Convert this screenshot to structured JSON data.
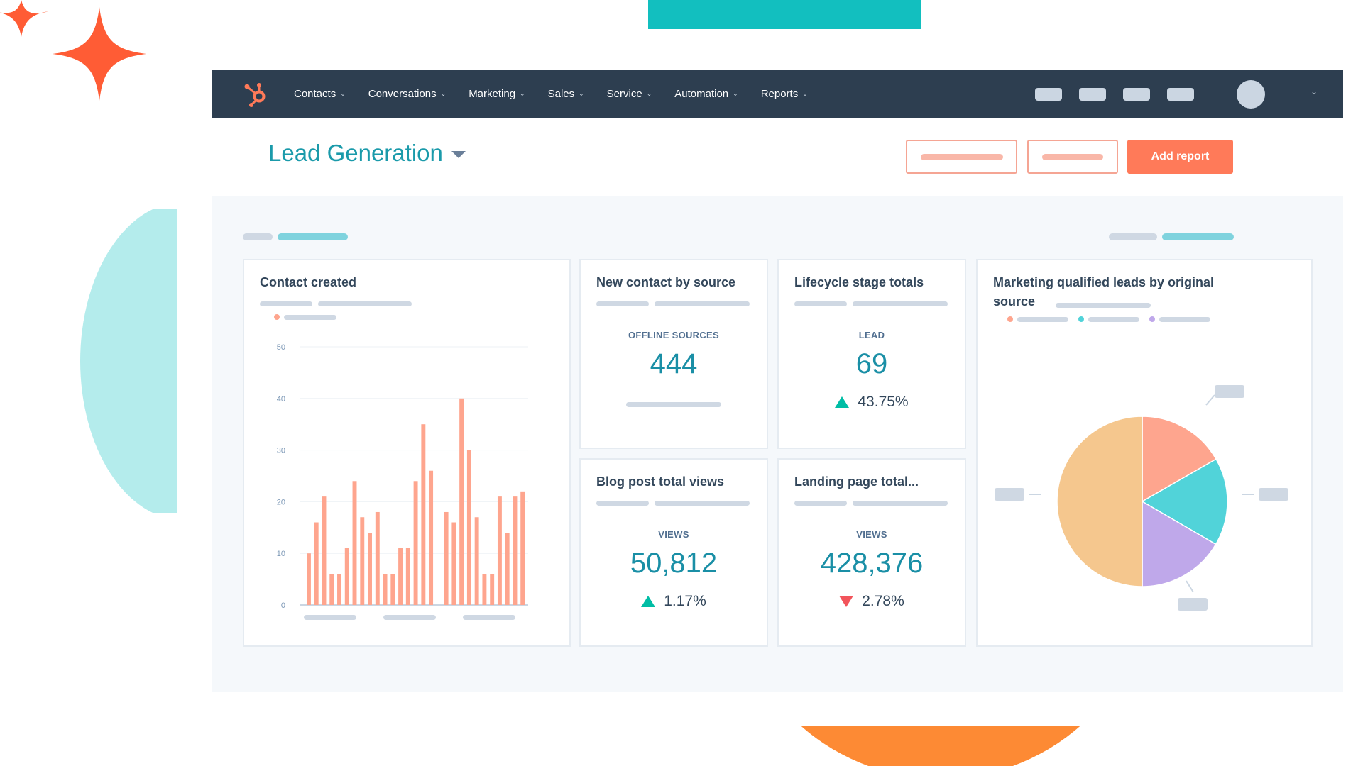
{
  "nav": {
    "logo": "hubspot-sprocket-icon",
    "items": [
      {
        "label": "Contacts"
      },
      {
        "label": "Conversations"
      },
      {
        "label": "Marketing"
      },
      {
        "label": "Sales"
      },
      {
        "label": "Service"
      },
      {
        "label": "Automation"
      },
      {
        "label": "Reports"
      }
    ],
    "chevron": "⌄"
  },
  "header": {
    "title": "Lead Generation",
    "add_report_label": "Add report"
  },
  "colors": {
    "nav_bg": "#2d3e50",
    "accent": "#ff7a59",
    "title": "#1a9aaa",
    "kpi_value": "#1a8fa6",
    "positive": "#00bda5",
    "negative": "#f2545b",
    "bar": "#fea58e"
  },
  "cards": {
    "contact_created": {
      "title": "Contact created"
    },
    "new_contact": {
      "title": "New contact by source",
      "label": "OFFLINE SOURCES",
      "value": "444"
    },
    "lifecycle": {
      "title": "Lifecycle stage totals",
      "label": "LEAD",
      "value": "69",
      "delta": "43.75%",
      "trend": "up"
    },
    "blog": {
      "title": "Blog post total views",
      "label": "VIEWS",
      "value": "50,812",
      "delta": "1.17%",
      "trend": "up"
    },
    "landing": {
      "title": "Landing page total...",
      "label": "VIEWS",
      "value": "428,376",
      "delta": "2.78%",
      "trend": "down"
    },
    "mql": {
      "title_line1": "Marketing qualified leads by original",
      "title_line2": "source"
    }
  },
  "chart_data": [
    {
      "type": "bar",
      "title": "Contact created",
      "xlabel": "",
      "ylabel": "",
      "ylim": [
        0,
        50
      ],
      "yticks": [
        "0",
        "10",
        "20",
        "30",
        "40",
        "50"
      ],
      "grid": true,
      "values": [
        10,
        16,
        21,
        6,
        6,
        11,
        24,
        17,
        14,
        18,
        6,
        6,
        11,
        11,
        24,
        35,
        26,
        null,
        18,
        16,
        40,
        30,
        17,
        6,
        6,
        21,
        14,
        21,
        22
      ],
      "color": "#fea58e"
    },
    {
      "type": "pie",
      "title": "Marketing qualified leads by original source",
      "slices": [
        {
          "value": 16.7,
          "color": "#fea58e"
        },
        {
          "value": 16.7,
          "color": "#51d3d9"
        },
        {
          "value": 16.6,
          "color": "#bfa8ea"
        },
        {
          "value": 50.0,
          "color": "#f5c78e"
        }
      ],
      "legend": "top-left"
    }
  ]
}
